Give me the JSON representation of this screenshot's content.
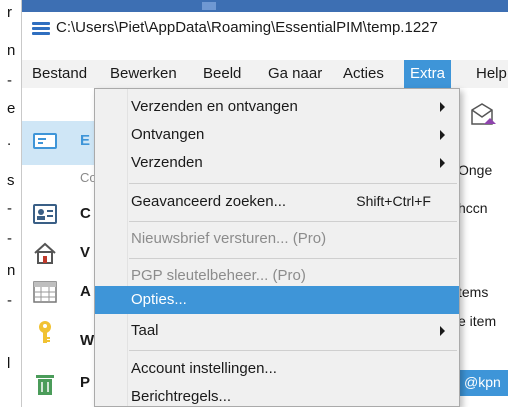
{
  "left_strip": {
    "chars": [
      "r",
      "n",
      "-",
      "e",
      ".",
      "s",
      "-",
      "-",
      "n",
      "-",
      "l"
    ]
  },
  "window": {
    "title": "C:\\Users\\Piet\\AppData\\Roaming\\EssentialPIM\\temp.1227"
  },
  "menubar": {
    "items": [
      {
        "label": "Bestand"
      },
      {
        "label": "Bewerken"
      },
      {
        "label": "Beeld"
      },
      {
        "label": "Ga naar"
      },
      {
        "label": "Acties"
      },
      {
        "label": "Extra"
      },
      {
        "label": "Help"
      }
    ]
  },
  "nav": {
    "items": [
      {
        "initial": "E",
        "sub": "Co"
      },
      {
        "initial": "C"
      },
      {
        "initial": "V"
      },
      {
        "initial": "A"
      },
      {
        "initial": "W"
      },
      {
        "initial": "P"
      }
    ]
  },
  "content": {
    "text1": "Onge",
    "text2": "hccn",
    "text3": "tems",
    "text4": "e item",
    "selected": "@kpn"
  },
  "dropdown": {
    "items": [
      {
        "label": "Verzenden en ontvangen"
      },
      {
        "label": "Ontvangen"
      },
      {
        "label": "Verzenden"
      },
      {
        "label": "Geavanceerd zoeken...",
        "shortcut": "Shift+Ctrl+F"
      },
      {
        "label": "Nieuwsbrief versturen... (Pro)"
      },
      {
        "label": "PGP sleutelbeheer... (Pro)"
      },
      {
        "label": "Opties..."
      },
      {
        "label": "Taal"
      },
      {
        "label": "Account instellingen..."
      },
      {
        "label": "Berichtregels..."
      }
    ]
  },
  "colors": {
    "accent": "#3e95d8",
    "highlight_nav": "#cfe6f6",
    "menubar": "#f2f2f2",
    "dropdown_bg": "#f0f0f0"
  }
}
